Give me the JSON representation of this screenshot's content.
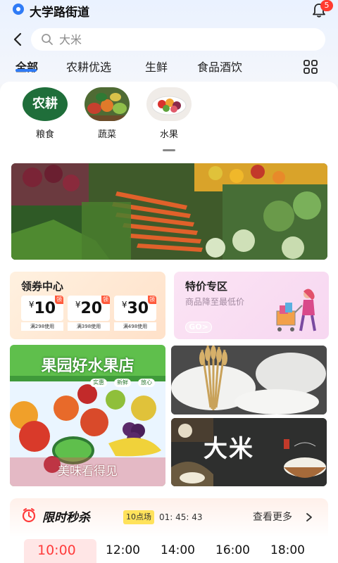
{
  "location": {
    "text": "大学路街道",
    "notification_count": "5"
  },
  "search": {
    "placeholder": "大米"
  },
  "tabs": [
    {
      "label": "全部",
      "active": true
    },
    {
      "label": "农耕优选"
    },
    {
      "label": "生鲜"
    },
    {
      "label": "食品酒饮"
    }
  ],
  "categories": [
    {
      "label": "粮食",
      "logo_text": "农耕"
    },
    {
      "label": "蔬菜"
    },
    {
      "label": "水果"
    }
  ],
  "coupon_center": {
    "title": "领券中心",
    "coupons": [
      {
        "currency": "¥",
        "amount": "10",
        "tag": "领",
        "condition": "满298使用"
      },
      {
        "currency": "¥",
        "amount": "20",
        "tag": "领",
        "condition": "满398使用"
      },
      {
        "currency": "¥",
        "amount": "30",
        "tag": "领",
        "condition": "满498使用"
      }
    ]
  },
  "special_offer": {
    "title": "特价专区",
    "subtitle": "商品降至最低价",
    "button": "GO>"
  },
  "fruit_promo": {
    "title": "果园好水果店",
    "tagline": "美味看得见",
    "badges": [
      "实惠",
      "新鲜",
      "放心"
    ]
  },
  "rice_promo": {
    "big_text": "大米"
  },
  "flash_sale": {
    "title": "限时秒杀",
    "session": "10点场",
    "countdown": "01: 45: 43",
    "more_label": "查看更多",
    "time_slots": [
      {
        "label": "10:00",
        "active": true
      },
      {
        "label": "12:00"
      },
      {
        "label": "14:00"
      },
      {
        "label": "16:00"
      },
      {
        "label": "18:00"
      }
    ]
  },
  "colors": {
    "accent": "#2f7bf6",
    "flash_red": "#ff3b3b",
    "badge_red": "#ff3b30"
  }
}
